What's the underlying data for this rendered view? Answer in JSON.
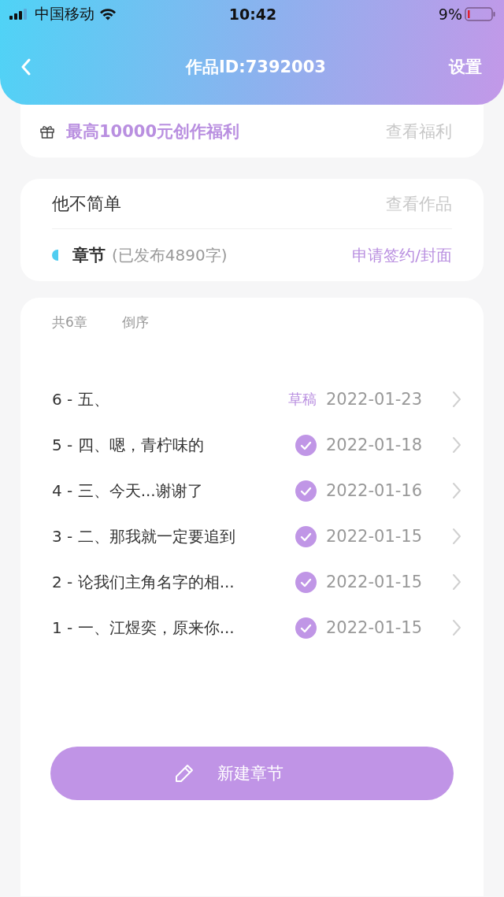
{
  "status_bar": {
    "carrier": "中国移动",
    "time": "10:42",
    "battery": "9%"
  },
  "nav": {
    "title": "作品ID:7392003",
    "action": "设置"
  },
  "promo": {
    "text": "最高10000元创作福利",
    "link": "查看福利"
  },
  "work": {
    "title": "他不简单",
    "link": "查看作品",
    "section": "章节",
    "section_note": "(已发布4890字)",
    "apply": "申请签约/封面"
  },
  "chapters_header": {
    "count": "共6章",
    "sort": "倒序"
  },
  "chapters": [
    {
      "title": "6 - 五、",
      "kind": "draft",
      "status": "草稿",
      "date": "2022-01-23"
    },
    {
      "title": "5 - 四、嗯，青柠味的",
      "kind": "published",
      "date": "2022-01-18"
    },
    {
      "title": "4 - 三、今天...谢谢了",
      "kind": "published",
      "date": "2022-01-16"
    },
    {
      "title": "3 - 二、那我就一定要追到",
      "kind": "published",
      "date": "2022-01-15"
    },
    {
      "title": "2 - 论我们主角名字的相...",
      "kind": "published",
      "date": "2022-01-15"
    },
    {
      "title": "1 - 一、江煜奕，原来你...",
      "kind": "published",
      "date": "2022-01-15"
    }
  ],
  "new_button": "新建章节"
}
